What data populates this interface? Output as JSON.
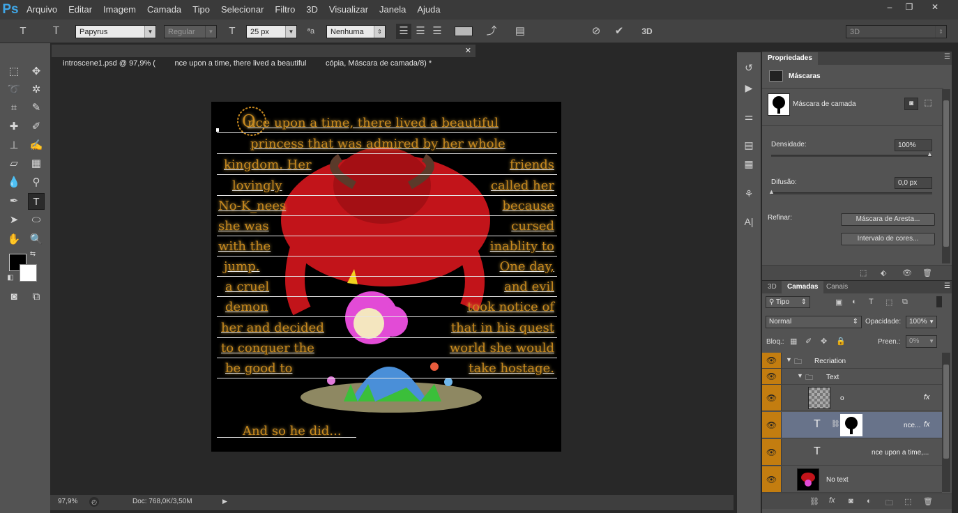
{
  "app": {
    "logo": "Ps"
  },
  "menu": [
    "Arquivo",
    "Editar",
    "Imagem",
    "Camada",
    "Tipo",
    "Selecionar",
    "Filtro",
    "3D",
    "Visualizar",
    "Janela",
    "Ajuda"
  ],
  "window_controls": {
    "minimize": "–",
    "restore": "❐",
    "close": "✕"
  },
  "options": {
    "font_family": "Papyrus",
    "font_style": "Regular",
    "font_size": "25 px",
    "aa_label": "ªa",
    "anti_alias": "Nenhuma",
    "threed_label": "3D",
    "workspace": "3D"
  },
  "document": {
    "tab_title": "introscene1.psd @ 97,9% (         nce upon a time, there lived a beautiful         cópia, Máscara de camada/8) *",
    "zoom": "97,9%",
    "doc_info": "Doc: 768,0K/3,50M"
  },
  "story_lines": [
    {
      "left": "nce upon a time, there lived a beautiful",
      "right": ""
    },
    {
      "left": "princess that was admired by her whole",
      "right": ""
    },
    {
      "left": "kingdom. Her",
      "right": "friends"
    },
    {
      "left": "lovingly",
      "right": "called her"
    },
    {
      "left": "No-K_nees",
      "right": "because"
    },
    {
      "left": "she was",
      "right": "cursed"
    },
    {
      "left": "with the",
      "right": "inablity to"
    },
    {
      "left": "jump.",
      "right": "One day,"
    },
    {
      "left": "a cruel",
      "right": "and evil"
    },
    {
      "left": "demon",
      "right": "took notice of"
    },
    {
      "left": "her and decided",
      "right": "that in his quest"
    },
    {
      "left": "to conquer the",
      "right": "world she would"
    },
    {
      "left": "be good to",
      "right": "take hostage."
    }
  ],
  "story_drop_cap": "O",
  "story_ending": "And so he did...",
  "properties": {
    "tab": "Propriedades",
    "section": "Máscaras",
    "mask_label": "Máscara de camada",
    "density_label": "Densidade:",
    "density_value": "100%",
    "feather_label": "Difusão:",
    "feather_value": "0,0 px",
    "refine_label": "Refinar:",
    "edge_button": "Máscara de Aresta...",
    "color_range_button": "Intervalo de cores..."
  },
  "layers_panel": {
    "tabs": [
      "3D",
      "Camadas",
      "Canais"
    ],
    "active_tab": "Camadas",
    "filter": "Tipo",
    "blend_mode": "Normal",
    "opacity_label": "Opacidade:",
    "opacity_value": "100%",
    "lock_label": "Bloq.:",
    "fill_label": "Preen.:",
    "fill_value": "0%",
    "layers": [
      {
        "name": "Recriation",
        "type": "group"
      },
      {
        "name": "Text",
        "type": "group"
      },
      {
        "name": "o",
        "type": "pixel",
        "fx": "fx"
      },
      {
        "name": "nce...",
        "type": "text-mask",
        "fx": "fx"
      },
      {
        "name": "nce upon a time,...",
        "type": "text"
      },
      {
        "name": "No text",
        "type": "pixel"
      }
    ]
  },
  "colors": {
    "accent_eye": "#c37d10",
    "text_gold": "#c8891e"
  }
}
